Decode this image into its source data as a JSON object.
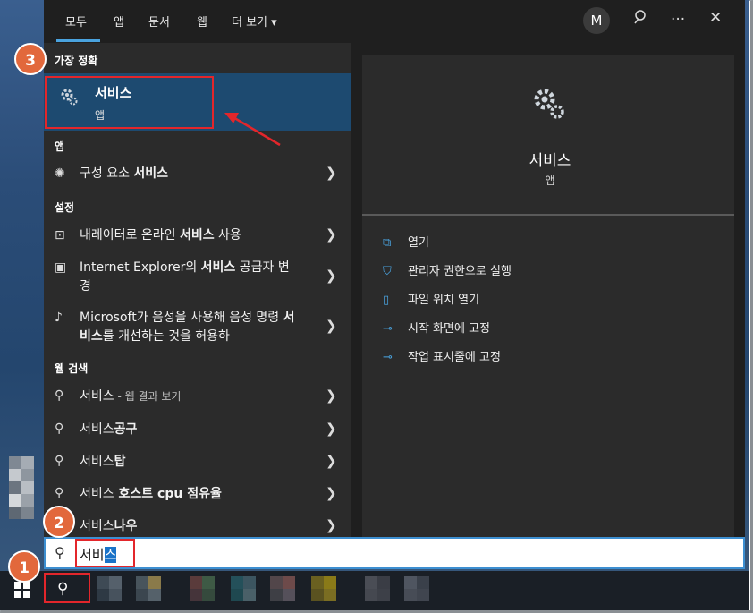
{
  "tabs": [
    {
      "label": "모두"
    },
    {
      "label": "앱"
    },
    {
      "label": "문서"
    },
    {
      "label": "웹"
    },
    {
      "label": "더 보기 ▾"
    }
  ],
  "header": {
    "avatar_initial": "M",
    "feedback_icon": "feedback-icon",
    "more_icon": "···",
    "close_icon": "✕"
  },
  "best_match": {
    "section": "가장 정확",
    "title": "서비스",
    "subtitle": "앱"
  },
  "apps": {
    "section": "앱",
    "items": [
      {
        "text": "구성 요소 ",
        "bold": "서비스"
      }
    ]
  },
  "settings": {
    "section": "설정",
    "items": [
      {
        "pre": "내레이터로 온라인 ",
        "bold": "서비스",
        "post": " 사용"
      },
      {
        "pre": "Internet Explorer의 ",
        "bold": "서비스",
        "post": " 공급자 변경"
      },
      {
        "pre": "Microsoft가 음성을 사용해 음성 명령 ",
        "bold": "서비스",
        "post": "를 개선하는 것을 허용하"
      }
    ]
  },
  "web": {
    "section": "웹 검색",
    "items": [
      {
        "text": "서비스",
        "suffix": " - 웹 결과 보기"
      },
      {
        "text": "서비스",
        "suffix": "공구"
      },
      {
        "text": "서비스",
        "suffix": "탑"
      },
      {
        "text": "서비스",
        "suffix": " 호스트 cpu 점유율"
      },
      {
        "text": "서비스",
        "suffix": "나우"
      }
    ]
  },
  "detail": {
    "title": "서비스",
    "subtitle": "앱",
    "actions": [
      {
        "label": "열기"
      },
      {
        "label": "관리자 권한으로 실행"
      },
      {
        "label": "파일 위치 열기"
      },
      {
        "label": "시작 화면에 고정"
      },
      {
        "label": "작업 표시줄에 고정"
      }
    ]
  },
  "search": {
    "typed": "서비",
    "selected": "스"
  },
  "annotations": {
    "b1": "1",
    "b2": "2",
    "b3": "3"
  },
  "colors": {
    "accent": "#4aa3df",
    "highlight": "#1d4a70",
    "annotation_red": "#e3262b",
    "badge": "#e2683c"
  }
}
